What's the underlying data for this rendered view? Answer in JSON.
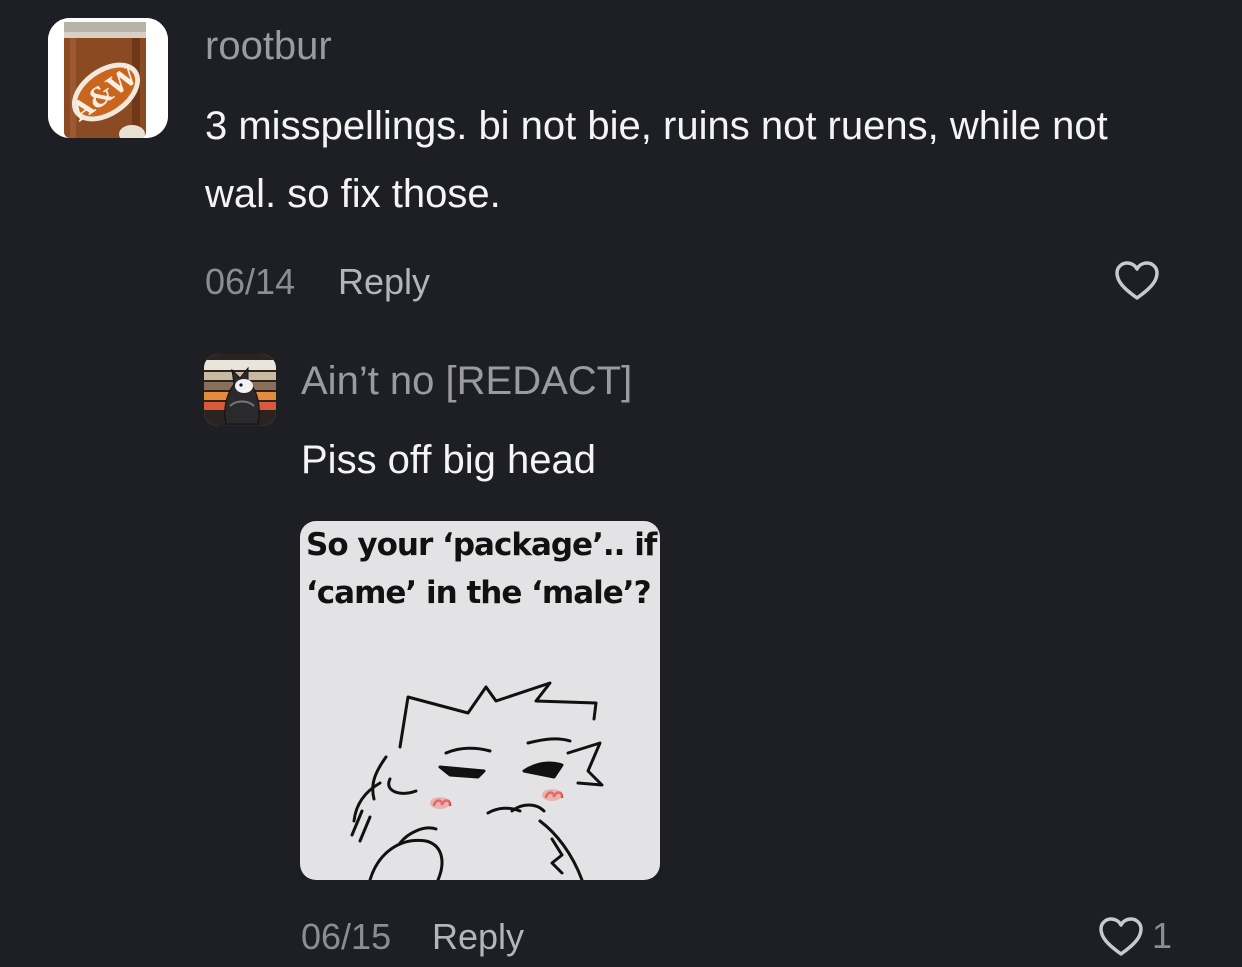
{
  "comment": {
    "username": "rootbur",
    "text": "3 misspellings. bi not bie, ruins not ruens, while not wal. so fix those.",
    "date": "06/14",
    "reply_label": "Reply",
    "avatar_icon": "aw-root-beer-can-avatar",
    "avatar_lettering": "A&W"
  },
  "reply": {
    "username": "Ain’t no [REDACT]",
    "text": "Piss off big head",
    "image_caption": "So your ‘package’.. if\n‘came’ in the ‘male’?",
    "date": "06/15",
    "reply_label": "Reply",
    "like_count": "1",
    "avatar_icon": "cartoon-character-avatar"
  },
  "colors": {
    "background": "#1e1f24",
    "username": "#9a9ba0",
    "body_text": "#f4f4f4",
    "meta_text": "#8c8d92"
  }
}
